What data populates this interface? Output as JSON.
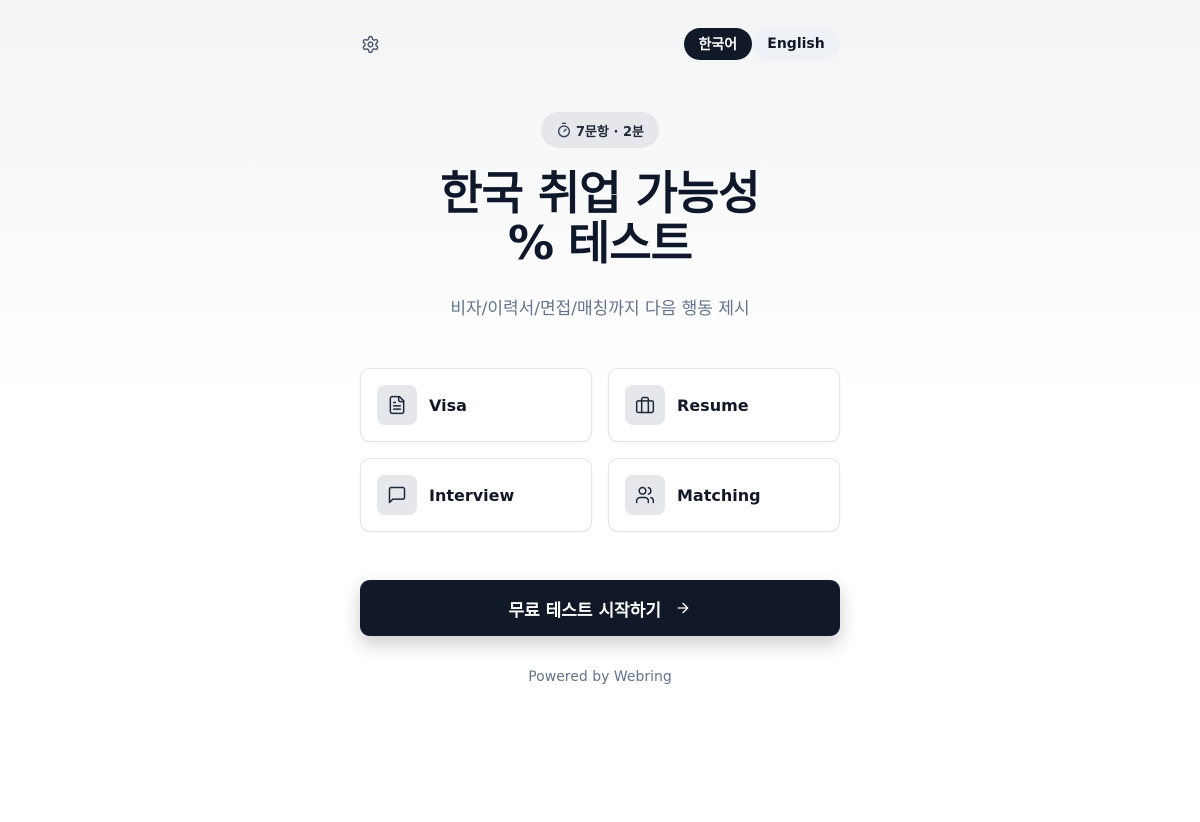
{
  "header": {
    "settings_icon": "gear-icon",
    "languages": [
      {
        "label": "한국어",
        "active": true
      },
      {
        "label": "English",
        "active": false
      }
    ]
  },
  "badge": {
    "icon": "stopwatch-icon",
    "text": "7문항 · 2분"
  },
  "hero": {
    "title_line1": "한국 취업 가능성",
    "title_line2": "% 테스트",
    "subtitle": "비자/이력서/면접/매칭까지 다음 행동 제시"
  },
  "cards": [
    {
      "label": "Visa",
      "icon": "document-icon"
    },
    {
      "label": "Resume",
      "icon": "briefcase-icon"
    },
    {
      "label": "Interview",
      "icon": "chat-icon"
    },
    {
      "label": "Matching",
      "icon": "users-icon"
    }
  ],
  "cta": {
    "label": "무료 테스트 시작하기",
    "icon": "arrow-right-icon"
  },
  "footer": {
    "text": "Powered by Webring"
  },
  "colors": {
    "primary_dark": "#111827",
    "muted_text": "#64748b",
    "card_border": "#e2e5ea",
    "icon_bg": "#e5e7eb"
  }
}
